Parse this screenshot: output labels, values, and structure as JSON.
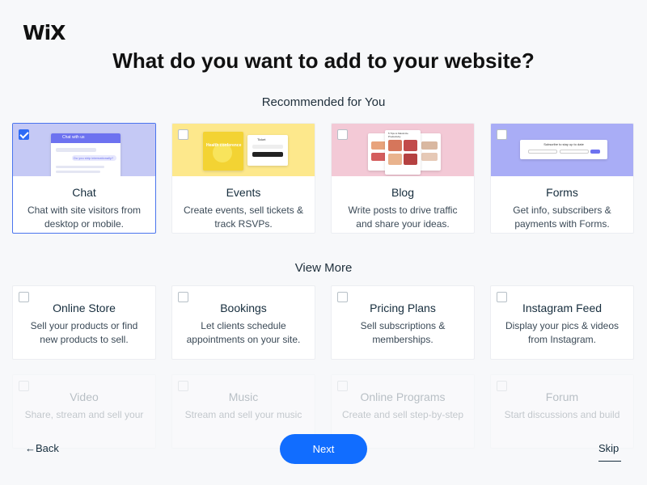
{
  "brand": {
    "logo": "WiX"
  },
  "page": {
    "title": "What do you want to add to your website?"
  },
  "recommended": {
    "label": "Recommended for You",
    "items": [
      {
        "title": "Chat",
        "desc": "Chat with site visitors from desktop or mobile.",
        "checked": true,
        "color": "#c5c9f5"
      },
      {
        "title": "Events",
        "desc": "Create events, sell tickets & track RSVPs.",
        "checked": false,
        "color": "#fde88c"
      },
      {
        "title": "Blog",
        "desc": "Write posts to drive traffic and share your ideas.",
        "checked": false,
        "color": "#f3c9d6"
      },
      {
        "title": "Forms",
        "desc": "Get info, subscribers & payments with Forms.",
        "checked": false,
        "color": "#a9adf6"
      }
    ]
  },
  "more": {
    "label": "View More",
    "items": [
      {
        "title": "Online Store",
        "desc": "Sell your products or find new products to sell."
      },
      {
        "title": "Bookings",
        "desc": "Let clients schedule appointments on your site."
      },
      {
        "title": "Pricing Plans",
        "desc": "Sell subscriptions & memberships."
      },
      {
        "title": "Instagram Feed",
        "desc": "Display your pics & videos from Instagram."
      }
    ],
    "faded_items": [
      {
        "title": "Video",
        "desc": "Share, stream and sell your"
      },
      {
        "title": "Music",
        "desc": "Stream and sell your music"
      },
      {
        "title": "Online Programs",
        "desc": "Create and sell step-by-step"
      },
      {
        "title": "Forum",
        "desc": "Start discussions and build"
      }
    ]
  },
  "thumbs": {
    "chat_header": "Chat with us",
    "chat_bubble": "Do you ship internationally?",
    "events_title": "Health conference",
    "events_ticket": "Ticket",
    "blog_heading": "5 Tips to Maximize Productivity",
    "forms_heading": "Subscribe to stay up to date"
  },
  "nav": {
    "back": "←Back",
    "next": "Next",
    "skip": "Skip"
  },
  "colors": {
    "accent": "#116dff",
    "checkbox": "#2e6cf6"
  }
}
